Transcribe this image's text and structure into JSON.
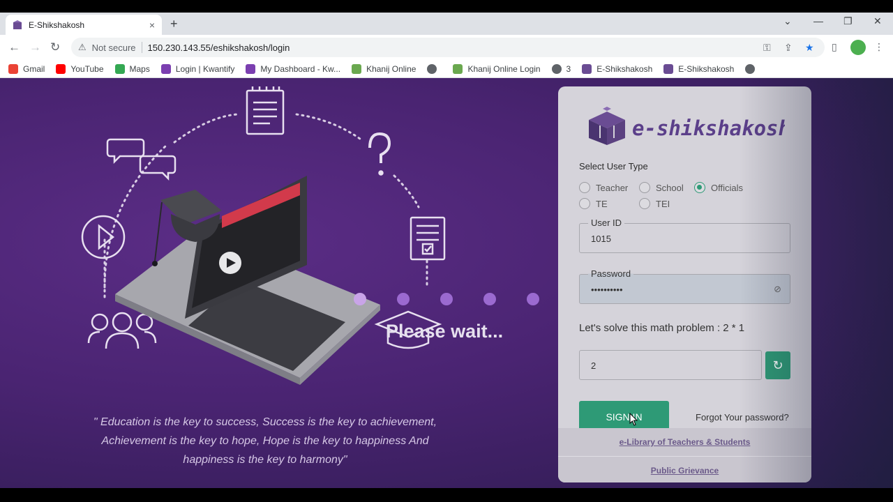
{
  "browser": {
    "tab_title": "E-Shikshakosh",
    "tab_close": "×",
    "new_tab": "+",
    "security_label": "Not secure",
    "url": "150.230.143.55/eshikshakosh/login",
    "win_min": "—",
    "win_restore": "❐",
    "win_close": "✕",
    "win_menu": "⌄"
  },
  "bookmarks": [
    {
      "label": "Gmail",
      "color": "#ea4335"
    },
    {
      "label": "YouTube",
      "color": "#ff0000"
    },
    {
      "label": "Maps",
      "color": "#34a853"
    },
    {
      "label": "Login | Kwantify",
      "color": "#7b3fb0"
    },
    {
      "label": "My Dashboard - Kw...",
      "color": "#7b3fb0"
    },
    {
      "label": "Khanij Online",
      "color": "#6aa84f"
    },
    {
      "label": "",
      "color": "#5f6368"
    },
    {
      "label": "Khanij Online Login",
      "color": "#6aa84f"
    },
    {
      "label": "3",
      "color": "#5f6368"
    },
    {
      "label": "E-Shikshakosh",
      "color": "#6a4c93"
    },
    {
      "label": "E-Shikshakosh",
      "color": "#6a4c93"
    },
    {
      "label": "",
      "color": "#5f6368"
    }
  ],
  "hero": {
    "quote": "\" Education is the key to success, Success is the key to achievement, Achievement is the key to hope, Hope is the key to happiness And happiness is the key to harmony\"",
    "loading_text": "Please wait..."
  },
  "login": {
    "logo_text": "e-shikshakosh",
    "user_type_label": "Select User Type",
    "user_types": [
      {
        "label": "Teacher",
        "selected": false
      },
      {
        "label": "School",
        "selected": false
      },
      {
        "label": "Officials",
        "selected": true
      },
      {
        "label": "TE",
        "selected": false
      },
      {
        "label": "TEI",
        "selected": false
      }
    ],
    "userid_label": "User ID",
    "userid_value": "1015",
    "password_label": "Password",
    "password_value": "••••••••••",
    "math_prompt": "Let's solve this math problem : 2 * 1",
    "math_answer": "2",
    "signin_label": "SIGN IN",
    "forgot_label": "Forgot Your password?",
    "elibrary_link": "e-Library of Teachers & Students",
    "grievance_link": "Public Grievance",
    "accent_color": "#2e9a76"
  }
}
